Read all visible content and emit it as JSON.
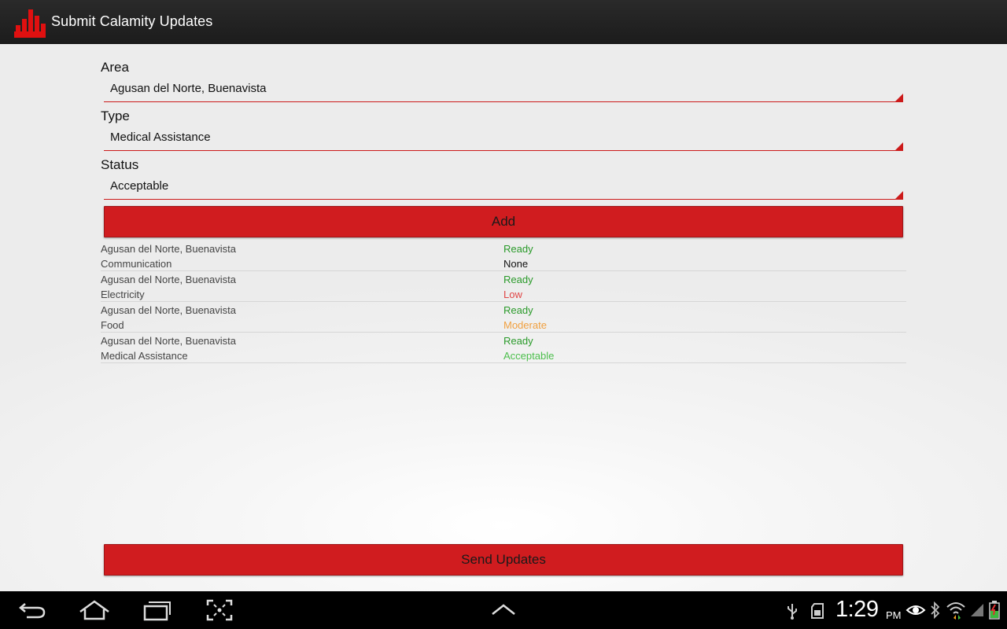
{
  "app": {
    "title": "Submit Calamity Updates",
    "accent": "#d01c1f"
  },
  "form": {
    "area": {
      "label": "Area",
      "value": "Agusan del Norte, Buenavista"
    },
    "type": {
      "label": "Type",
      "value": "Medical Assistance"
    },
    "status": {
      "label": "Status",
      "value": "Acceptable"
    },
    "add_label": "Add"
  },
  "entries": [
    {
      "area": "Agusan del Norte, Buenavista",
      "type": "Communication",
      "ready": "Ready",
      "status": "None",
      "status_color": "#111111"
    },
    {
      "area": "Agusan del Norte, Buenavista",
      "type": "Electricity",
      "ready": "Ready",
      "status": "Low",
      "status_color": "#e04545"
    },
    {
      "area": "Agusan del Norte, Buenavista",
      "type": "Food",
      "ready": "Ready",
      "status": "Moderate",
      "status_color": "#f0a040"
    },
    {
      "area": "Agusan del Norte, Buenavista",
      "type": "Medical Assistance",
      "ready": "Ready",
      "status": "Acceptable",
      "status_color": "#4cbf4c"
    }
  ],
  "ready_color": "#2a9a2a",
  "send_label": "Send Updates",
  "system_bar": {
    "time": "1:29",
    "ampm": "PM",
    "icons": [
      "back-icon",
      "home-icon",
      "recent-apps-icon",
      "screenshot-icon",
      "up-chevron-icon",
      "usb-icon",
      "sd-card-icon",
      "eye-icon",
      "bluetooth-icon",
      "wifi-icon",
      "signal-icon",
      "battery-icon"
    ]
  }
}
